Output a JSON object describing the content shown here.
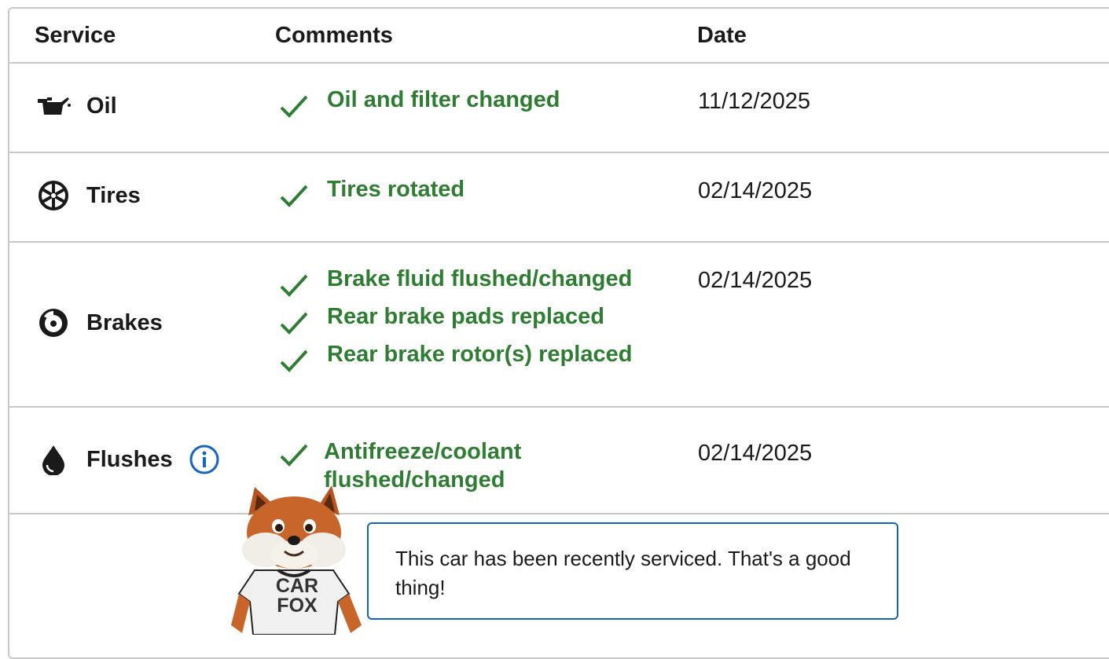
{
  "table": {
    "headers": {
      "service": "Service",
      "comments": "Comments",
      "date": "Date"
    },
    "rows": [
      {
        "service": "Oil",
        "icon": "oil-can-icon",
        "comments": [
          "Oil and filter changed"
        ],
        "date": "11/12/2025"
      },
      {
        "service": "Tires",
        "icon": "tire-icon",
        "comments": [
          "Tires rotated"
        ],
        "date": "02/14/2025"
      },
      {
        "service": "Brakes",
        "icon": "brake-disc-icon",
        "comments": [
          "Brake fluid flushed/changed",
          "Rear brake pads replaced",
          "Rear brake rotor(s) replaced"
        ],
        "date": "02/14/2025"
      },
      {
        "service": "Flushes",
        "icon": "drop-icon",
        "info_icon": "info-icon",
        "comments": [
          "Antifreeze/coolant flushed/changed"
        ],
        "date": "02/14/2025"
      }
    ]
  },
  "mascot": {
    "shirt_line1": "CAR",
    "shirt_line2": "FOX"
  },
  "bubble": {
    "message": "This car has been recently serviced. That's a good thing!"
  },
  "colors": {
    "comment_green": "#2e7d32",
    "info_blue": "#1565c0",
    "border_gray": "#c8c8c8"
  }
}
